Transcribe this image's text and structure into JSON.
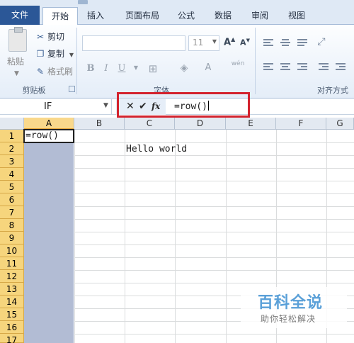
{
  "ribbon": {
    "tabs": [
      {
        "label": "文件"
      },
      {
        "label": "开始"
      },
      {
        "label": "插入"
      },
      {
        "label": "页面布局"
      },
      {
        "label": "公式"
      },
      {
        "label": "数据"
      },
      {
        "label": "审阅"
      },
      {
        "label": "视图"
      }
    ],
    "clipboard": {
      "paste": "粘贴",
      "cut": "剪切",
      "copy": "复制",
      "format_painter": "格式刷",
      "group_label": "剪贴板"
    },
    "font": {
      "size": "11",
      "group_label": "字体",
      "bold": "B",
      "italic": "I",
      "underline": "U",
      "grow": "A",
      "shrink": "A",
      "color": "A",
      "phonetic": "wén"
    },
    "alignment": {
      "group_label": "对齐方式"
    }
  },
  "formula_bar": {
    "name_box": "IF",
    "cancel": "✕",
    "enter": "✔",
    "fx": "fx",
    "content": "=row()"
  },
  "sheet": {
    "columns": [
      "A",
      "B",
      "C",
      "D",
      "E",
      "F",
      "G"
    ],
    "rows": [
      "1",
      "2",
      "3",
      "4",
      "5",
      "6",
      "7",
      "8",
      "9",
      "10",
      "11",
      "12",
      "13",
      "14",
      "15",
      "16",
      "17"
    ],
    "cells": {
      "A1": "=row()",
      "C2": "Hello world"
    }
  },
  "watermark": {
    "title": "百科全说",
    "subtitle": "助你轻松解决"
  },
  "colors": {
    "file_tab": "#2b5797",
    "selection": "#b2bcd4",
    "row_header_selected": "#f6d57d",
    "highlight": "#d3232e"
  }
}
